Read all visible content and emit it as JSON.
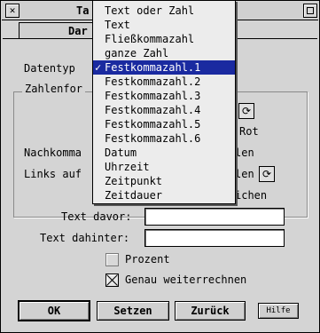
{
  "window": {
    "title": "Ta",
    "close_glyph": "✕"
  },
  "tab": {
    "label": "Dar"
  },
  "datentyp": {
    "label": "Datentyp"
  },
  "group": {
    "title": "Zahlenfor"
  },
  "row1": {
    "trailing": "Rot"
  },
  "row2": {
    "label": "Nachkomma",
    "trailing": "len"
  },
  "row3": {
    "label": "Links auf",
    "trailing": "len"
  },
  "row4": {
    "trailing": "ichen"
  },
  "text_davor": {
    "label": "Text davor:",
    "value": ""
  },
  "text_dahinter": {
    "label": "Text dahinter:",
    "value": ""
  },
  "prozent": {
    "label": "Prozent",
    "checked": false
  },
  "genau": {
    "label": "Genau weiterrechnen",
    "checked": true
  },
  "buttons": {
    "ok": "OK",
    "setzen": "Setzen",
    "zurueck": "Zurück",
    "hilfe": "Hilfe"
  },
  "menu": {
    "selected_index": 4,
    "check_glyph": "✓",
    "items": [
      "Text oder Zahl",
      "Text",
      "Fließkommazahl",
      "ganze Zahl",
      "Festkommazahl.1",
      "Festkommazahl.2",
      "Festkommazahl.3",
      "Festkommazahl.4",
      "Festkommazahl.5",
      "Festkommazahl.6",
      "Datum",
      "Uhrzeit",
      "Zeitpunkt",
      "Zeitdauer"
    ]
  },
  "colors": {
    "highlight": "#1a2aa0",
    "background": "#d4d4d4"
  }
}
